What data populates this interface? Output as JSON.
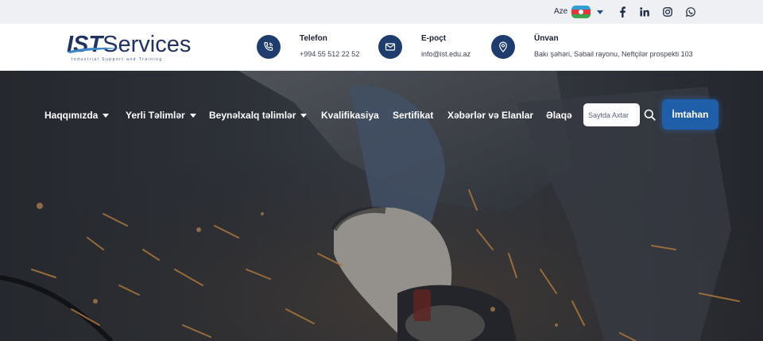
{
  "topbar": {
    "language": "Aze",
    "icons": {
      "flag": "azerbaijan-flag-icon",
      "social": [
        "facebook-icon",
        "linkedin-icon",
        "instagram-icon",
        "whatsapp-icon"
      ]
    }
  },
  "logo": {
    "brand_prefix": "IST",
    "brand_suffix": "Services",
    "tagline": "Industrial Support and Training"
  },
  "contacts": [
    {
      "title": "Telefon",
      "value": "+994 55 512 22 52",
      "icon": "phone-icon"
    },
    {
      "title": "E-poçt",
      "value": "info@ist.edu.az",
      "icon": "mail-icon"
    },
    {
      "title": "Ünvan",
      "value": "Bakı şəhəri, Səbail rayonu, Neftçilər prospekti 103",
      "icon": "location-pin-icon"
    }
  ],
  "nav": {
    "items": [
      {
        "label": "Haqqımızda",
        "has_dropdown": true
      },
      {
        "label": "Yerli Təlimlər",
        "has_dropdown": true
      },
      {
        "label": "Beynəlxalq təlimlər",
        "has_dropdown": true
      },
      {
        "label": "Kvalifikasiya",
        "has_dropdown": false
      },
      {
        "label": "Sertifikat",
        "has_dropdown": false
      },
      {
        "label": "Xəbərlər və Elanlar",
        "has_dropdown": false
      },
      {
        "label": "Əlaqə",
        "has_dropdown": false
      }
    ],
    "search_placeholder": "Saytda Axtar",
    "exam_button": "İmtahan"
  },
  "colors": {
    "brand_navy": "#1f3c6e",
    "button_blue": "#1f5ea8",
    "topbar_bg": "#eef0f3"
  }
}
